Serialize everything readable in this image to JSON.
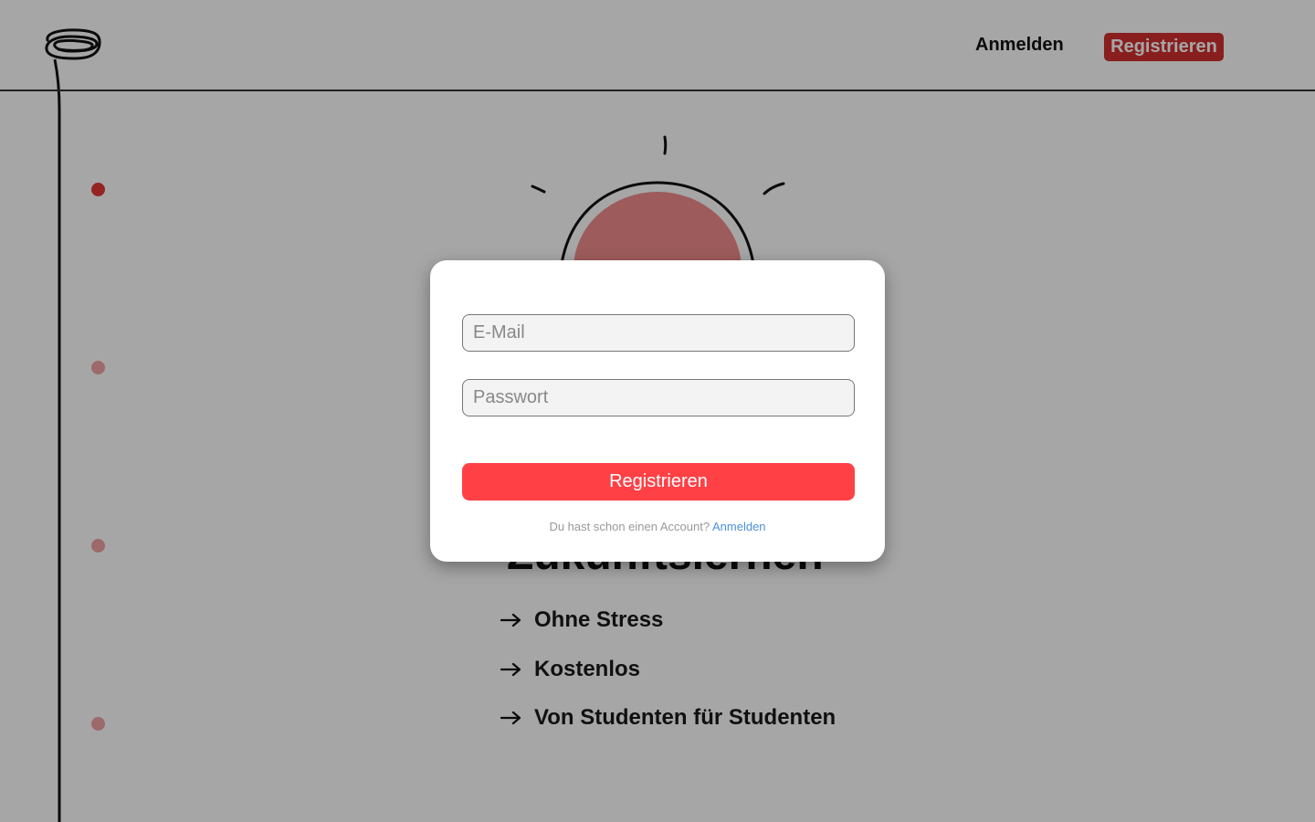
{
  "header": {
    "login_label": "Anmelden",
    "register_label": "Registrieren"
  },
  "hero": {
    "title": "Zukunftslernen",
    "features": [
      {
        "label": "Ohne Stress"
      },
      {
        "label": "Kostenlos"
      },
      {
        "label": "Von Studenten für Studenten"
      }
    ]
  },
  "modal": {
    "email_placeholder": "E-Mail",
    "email_value": "",
    "password_placeholder": "Passwort",
    "password_value": "",
    "submit_label": "Registrieren",
    "footer_text": "Du hast schon einen Account?",
    "footer_link": "Anmelden"
  },
  "timeline": {
    "steps": 4,
    "active_step": 1
  },
  "colors": {
    "accent": "#ff4146",
    "nav_button": "#d32f2f",
    "link": "#4a8fd8"
  },
  "icons": {
    "logo": "scribble-logo-icon",
    "feature": "arrow-right-icon",
    "hero": "sun-icon"
  }
}
